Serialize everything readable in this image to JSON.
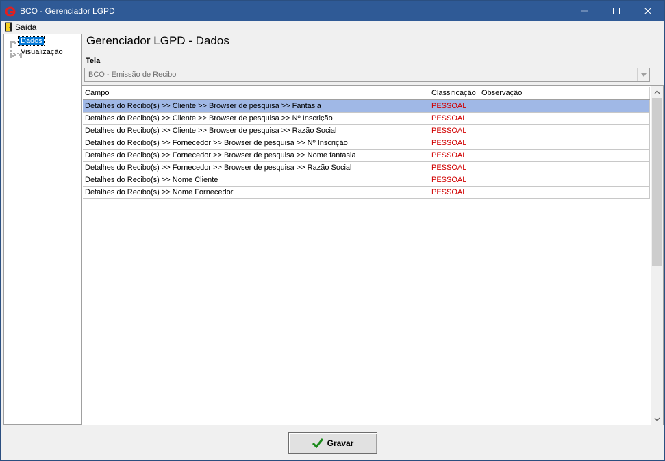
{
  "window": {
    "title": "BCO - Gerenciador LGPD",
    "colors": {
      "titlebar": "#2f5a96",
      "selection": "#a0b8e6",
      "classification": "#d00000"
    }
  },
  "menu": {
    "items": [
      {
        "label": "Saída",
        "icon": "exit-icon"
      }
    ]
  },
  "tree": {
    "items": [
      {
        "label": "Dados",
        "selected": true
      },
      {
        "label": "Visualização",
        "selected": false
      }
    ]
  },
  "page": {
    "title": "Gerenciador LGPD - Dados"
  },
  "tela": {
    "label": "Tela",
    "value": "BCO - Emissão de Recibo"
  },
  "grid": {
    "columns": [
      "Campo",
      "Classificação",
      "Observação"
    ],
    "rows": [
      {
        "campo": "Detalhes do Recibo(s) >> Cliente >> Browser de pesquisa >> Fantasia",
        "classificacao": "PESSOAL",
        "observacao": ""
      },
      {
        "campo": "Detalhes do Recibo(s) >> Cliente >> Browser de pesquisa >> Nº Inscrição",
        "classificacao": "PESSOAL",
        "observacao": ""
      },
      {
        "campo": "Detalhes do Recibo(s) >> Cliente >> Browser de pesquisa >> Razão Social",
        "classificacao": "PESSOAL",
        "observacao": ""
      },
      {
        "campo": "Detalhes do Recibo(s) >> Fornecedor >> Browser de pesquisa >> Nº Inscrição",
        "classificacao": "PESSOAL",
        "observacao": ""
      },
      {
        "campo": "Detalhes do Recibo(s) >> Fornecedor >> Browser de pesquisa >> Nome fantasia",
        "classificacao": "PESSOAL",
        "observacao": ""
      },
      {
        "campo": "Detalhes do Recibo(s) >> Fornecedor >> Browser de pesquisa >> Razão Social",
        "classificacao": "PESSOAL",
        "observacao": ""
      },
      {
        "campo": "Detalhes do Recibo(s) >> Nome Cliente",
        "classificacao": "PESSOAL",
        "observacao": ""
      },
      {
        "campo": "Detalhes do Recibo(s) >> Nome Fornecedor",
        "classificacao": "PESSOAL",
        "observacao": ""
      }
    ]
  },
  "actions": {
    "save_label": "Gravar",
    "save_accel": "G",
    "save_rest": "ravar"
  }
}
